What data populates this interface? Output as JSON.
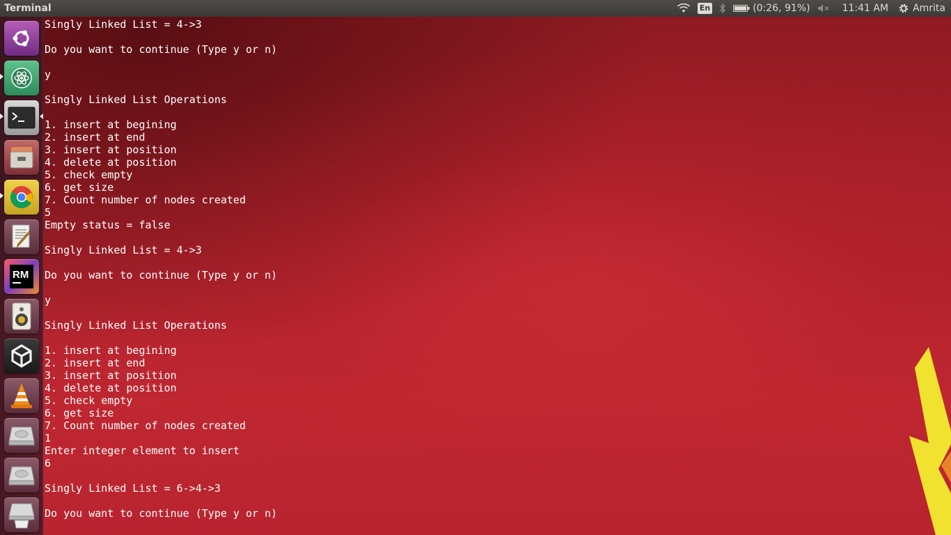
{
  "top_panel": {
    "app_title": "Terminal",
    "language": "En",
    "battery": "(0:26, 91%)",
    "clock": "11:41 AM",
    "user": "Amrita"
  },
  "launcher": {
    "items": [
      {
        "name": "ubuntu-dash",
        "icon": "ubuntu-logo-icon"
      },
      {
        "name": "atom",
        "icon": "atom-icon"
      },
      {
        "name": "terminal",
        "icon": "terminal-icon"
      },
      {
        "name": "files",
        "icon": "file-cabinet-icon"
      },
      {
        "name": "chrome",
        "icon": "chrome-icon"
      },
      {
        "name": "text-editor",
        "icon": "text-editor-icon"
      },
      {
        "name": "rubymine",
        "icon": "rubymine-icon",
        "label": "RM"
      },
      {
        "name": "rhythmbox",
        "icon": "speaker-icon"
      },
      {
        "name": "unity",
        "icon": "unity-icon"
      },
      {
        "name": "vlc",
        "icon": "vlc-cone-icon"
      },
      {
        "name": "drive-1",
        "icon": "hard-drive-icon"
      },
      {
        "name": "drive-2",
        "icon": "hard-drive-icon"
      },
      {
        "name": "trash",
        "icon": "trash-icon"
      }
    ]
  },
  "terminal": {
    "lines": [
      "Singly Linked List = 4->3",
      "",
      "Do you want to continue (Type y or n)",
      "",
      "y",
      "",
      "Singly Linked List Operations",
      "",
      "1. insert at begining",
      "2. insert at end",
      "3. insert at position",
      "4. delete at position",
      "5. check empty",
      "6. get size",
      "7. Count number of nodes created",
      "5",
      "Empty status = false",
      "",
      "Singly Linked List = 4->3",
      "",
      "Do you want to continue (Type y or n)",
      "",
      "y",
      "",
      "Singly Linked List Operations",
      "",
      "1. insert at begining",
      "2. insert at end",
      "3. insert at position",
      "4. delete at position",
      "5. check empty",
      "6. get size",
      "7. Count number of nodes created",
      "1",
      "Enter integer element to insert",
      "6",
      "",
      "Singly Linked List = 6->4->3",
      "",
      "Do you want to continue (Type y or n)"
    ]
  },
  "colors": {
    "panel": "#3b3a36",
    "wallpaper": "#b8232e",
    "terminal_text": "#ffffff"
  }
}
